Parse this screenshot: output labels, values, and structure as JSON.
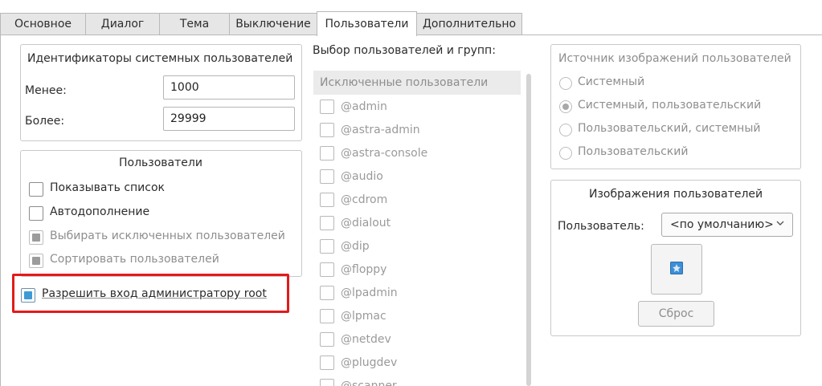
{
  "tabs": [
    {
      "label": "Основное",
      "active": false
    },
    {
      "label": "Диалог",
      "active": false
    },
    {
      "label": "Тема",
      "active": false
    },
    {
      "label": "Выключение",
      "active": false
    },
    {
      "label": "Пользователи",
      "active": true
    },
    {
      "label": "Дополнительно",
      "active": false
    }
  ],
  "system_ids": {
    "title": "Идентификаторы системных пользователей",
    "less_label": "Менее:",
    "less_value": "1000",
    "more_label": "Более:",
    "more_value": "29999"
  },
  "users_group": {
    "title": "Пользователи",
    "items": [
      {
        "label": "Показывать список",
        "state": "unchecked",
        "enabled": true
      },
      {
        "label": "Автодополнение",
        "state": "unchecked",
        "enabled": true
      },
      {
        "label": "Выбирать исключенных пользователей",
        "state": "partial",
        "enabled": false
      },
      {
        "label": "Сортировать пользователей",
        "state": "partial",
        "enabled": false
      }
    ]
  },
  "root_login": {
    "label": "Разрешить вход администратору root",
    "checked": true
  },
  "selection": {
    "title": "Выбор пользователей и групп:",
    "header": "Исключенные пользователи",
    "items": [
      "@admin",
      "@astra-admin",
      "@astra-console",
      "@audio",
      "@cdrom",
      "@dialout",
      "@dip",
      "@floppy",
      "@lpadmin",
      "@lpmac",
      "@netdev",
      "@plugdev",
      "@scanner"
    ]
  },
  "image_source": {
    "title": "Источник изображений пользователей",
    "options": [
      {
        "label": "Системный",
        "selected": false
      },
      {
        "label": "Системный, пользовательский",
        "selected": true
      },
      {
        "label": "Пользовательский, системный",
        "selected": false
      },
      {
        "label": "Пользовательский",
        "selected": false
      }
    ]
  },
  "user_images": {
    "title": "Изображения пользователей",
    "user_label": "Пользователь:",
    "user_value": "<по умолчанию>",
    "reset_label": "Сброс"
  },
  "colors": {
    "accent": "#3c9ad7",
    "highlight": "#e21b1b"
  }
}
